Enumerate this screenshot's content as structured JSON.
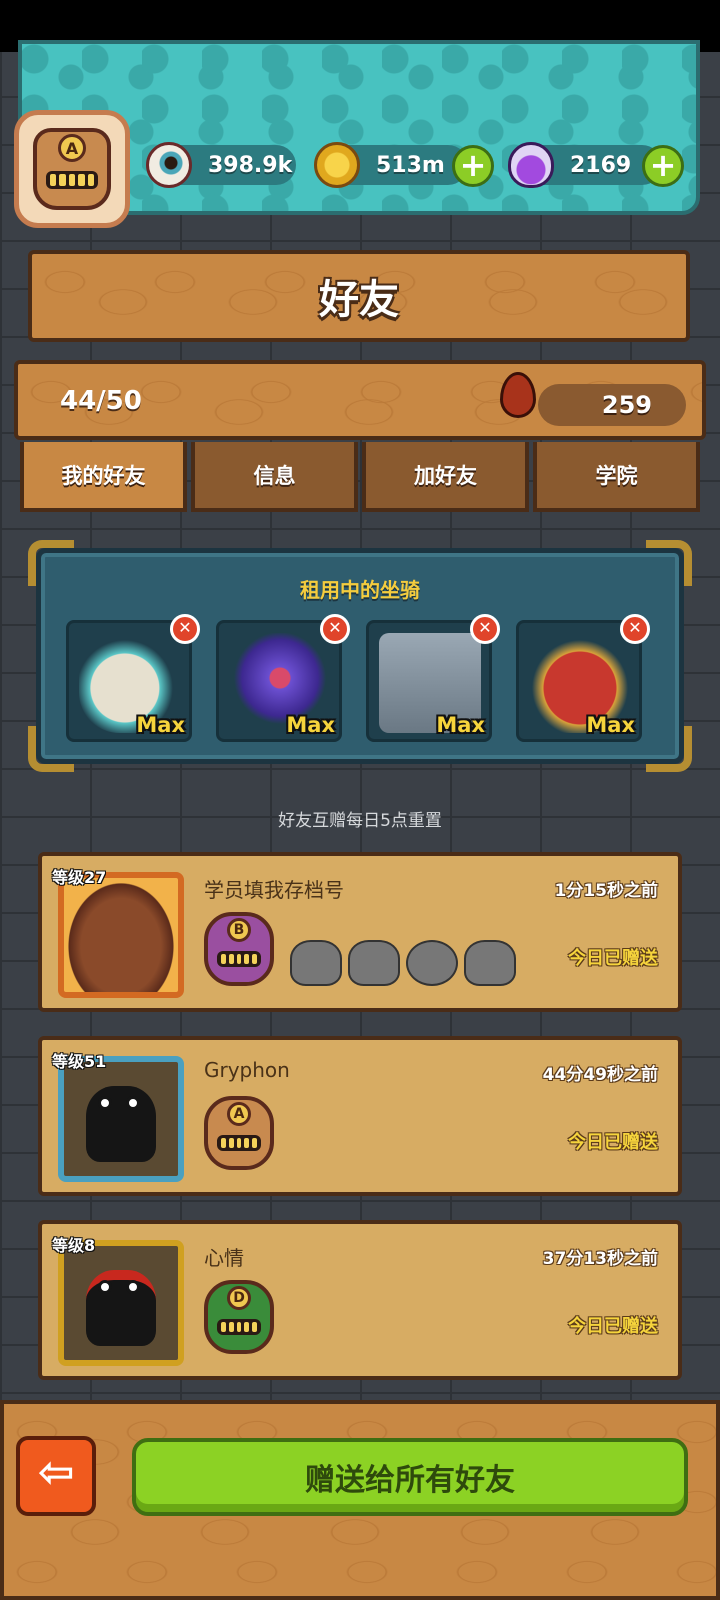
{
  "resources": {
    "eyeballs": "398.9k",
    "coins": "513m",
    "potions": "2169",
    "plus_symbol": "+"
  },
  "player": {
    "rank_letter": "A"
  },
  "header": {
    "title": "好友"
  },
  "friends_count": "44/50",
  "blood": "259",
  "tabs": [
    "我的好友",
    "信息",
    "加好友",
    "学院"
  ],
  "rented_mounts": {
    "title": "租用中的坐骑",
    "items": [
      {
        "level": "Max",
        "color": "#d9d2c0"
      },
      {
        "level": "Max",
        "color": "#5b3fa8"
      },
      {
        "level": "Max",
        "color": "#8a98a4"
      },
      {
        "level": "Max",
        "color": "#b8322a"
      }
    ],
    "remove_symbol": "✕"
  },
  "reset_note": "好友互赠每日5点重置",
  "friends": [
    {
      "level": "等级27",
      "name": "学员填我存档号",
      "time": "1分15秒之前",
      "status": "今日已赠送",
      "rank": "B",
      "rank_color": "#9a4fa0",
      "frame_color": "#d36a22"
    },
    {
      "level": "等级51",
      "name": "Gryphon",
      "time": "44分49秒之前",
      "status": "今日已赠送",
      "rank": "A",
      "rank_color": "#c88a4f",
      "frame_color": "#4aa0c0"
    },
    {
      "level": "等级8",
      "name": "心情",
      "time": "37分13秒之前",
      "status": "今日已赠送",
      "rank": "D",
      "rank_color": "#3a8c3a",
      "frame_color": "#d0a020"
    }
  ],
  "actions": {
    "back_symbol": "⇦",
    "gift_all": "赠送给所有好友"
  }
}
